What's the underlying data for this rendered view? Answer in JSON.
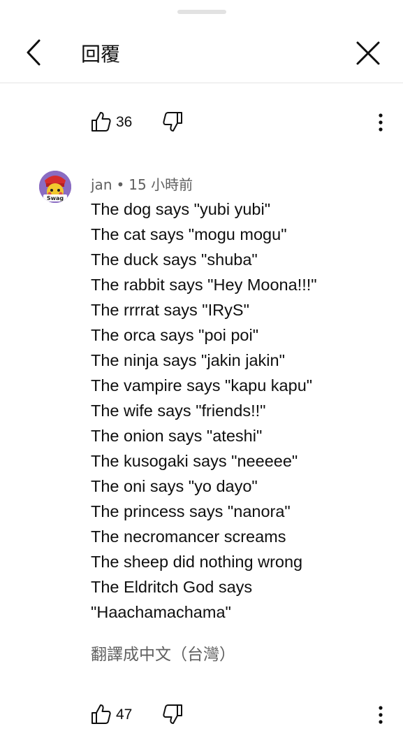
{
  "header": {
    "title": "回覆"
  },
  "top_actions": {
    "like_count": "36"
  },
  "comment": {
    "author": "jan",
    "separator": "•",
    "time": "15 小時前",
    "avatar_text": "Swag",
    "lines": [
      "The dog says \"yubi yubi\"",
      "The cat says \"mogu mogu\"",
      "The duck says \"shuba\"",
      "The rabbit says \"Hey Moona!!!\"",
      "The rrrrat says \"IRyS\"",
      "The orca says \"poi poi\"",
      "The ninja says \"jakin jakin\"",
      "The vampire says \"kapu kapu\"",
      "The wife says \"friends!!\"",
      "The onion says \"ateshi\"",
      "The kusogaki says \"neeeee\"",
      "The oni says \"yo dayo\"",
      "The princess says \"nanora\"",
      "The necromancer screams",
      "The sheep did nothing wrong",
      "The Eldritch God says",
      "\"Haachamachama\""
    ],
    "translate_label": "翻譯成中文（台灣）",
    "like_count": "47"
  },
  "icons": {
    "back": "chevron-left-icon",
    "close": "close-icon",
    "like": "thumbs-up-icon",
    "dislike": "thumbs-down-icon",
    "more": "more-vertical-icon"
  }
}
